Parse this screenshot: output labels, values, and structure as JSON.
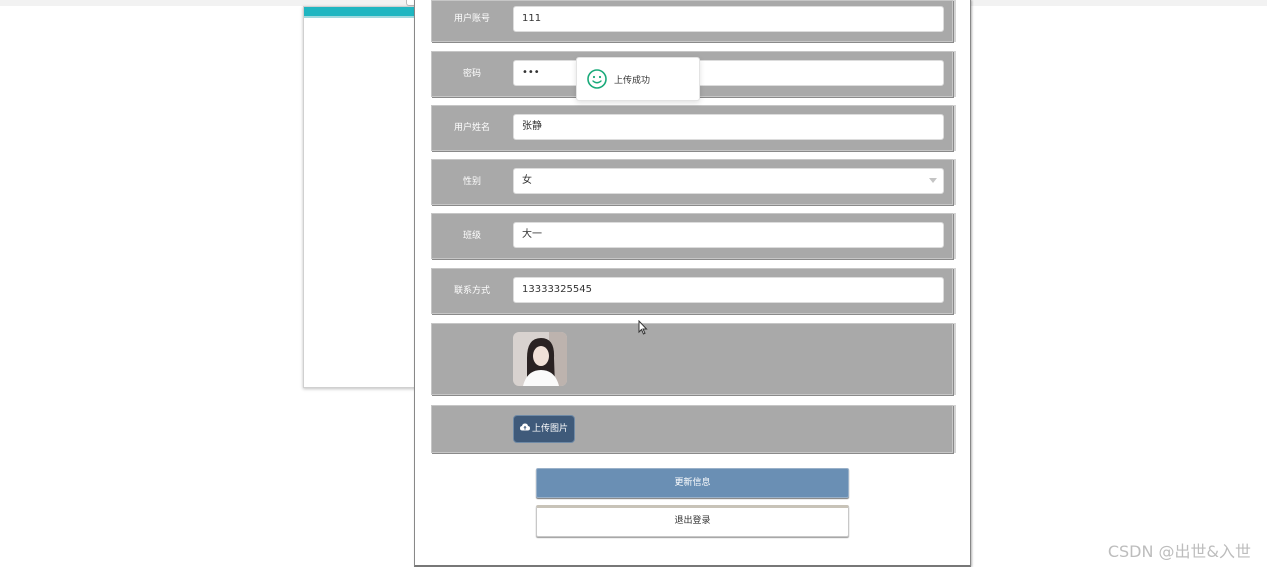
{
  "form": {
    "fields": [
      {
        "label": "用户账号",
        "value": "111"
      },
      {
        "label": "密码",
        "value": "•••"
      },
      {
        "label": "用户姓名",
        "value": "张静"
      },
      {
        "label": "性别",
        "value": "女"
      },
      {
        "label": "班级",
        "value": "大一"
      },
      {
        "label": "联系方式",
        "value": "13333325545"
      }
    ],
    "upload_label": "上传图片",
    "update_label": "更新信息",
    "logout_label": "退出登录"
  },
  "toast": {
    "message": "上传成功"
  },
  "watermark": "CSDN @出世&入世",
  "colors": {
    "row_bg": "#a9a9a9",
    "update_button": "#6a8fb4",
    "upload_button": "#3f5a7a",
    "success_icon": "#1aaa7a",
    "accent_teal": "#1fb6c1"
  }
}
